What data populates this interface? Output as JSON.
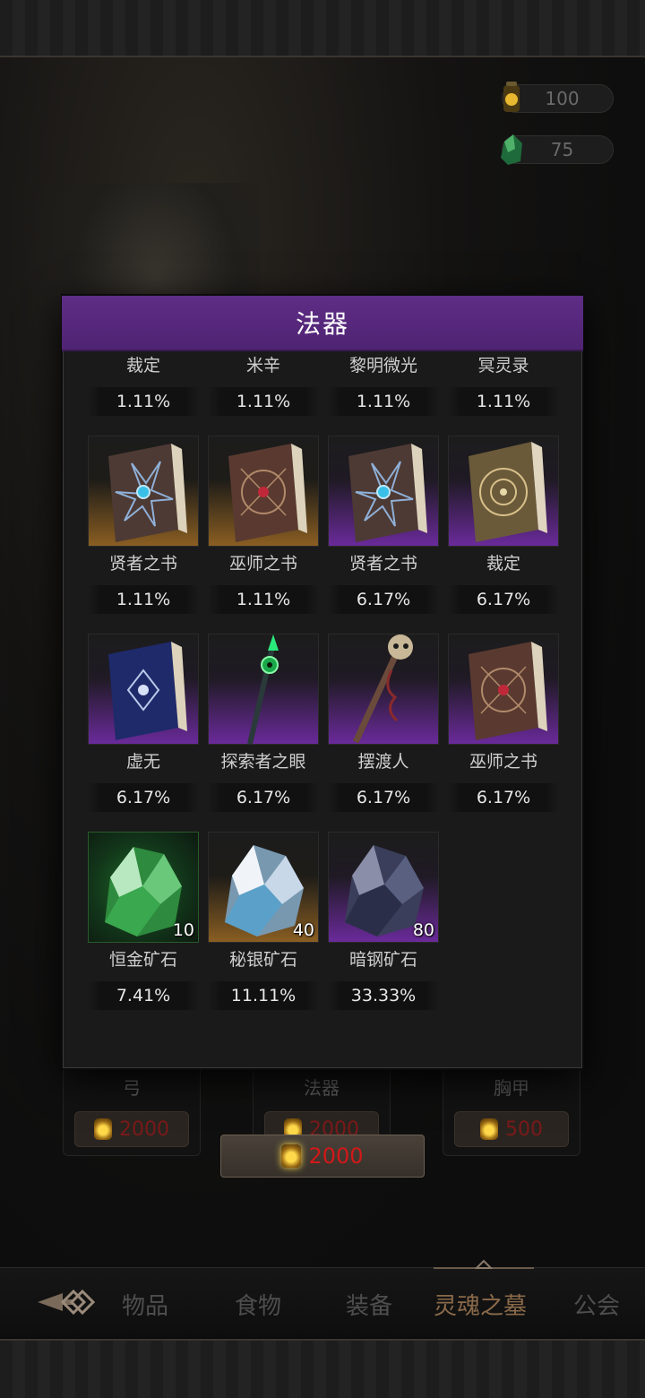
{
  "resources": [
    {
      "icon": "lantern-icon",
      "value": "100"
    },
    {
      "icon": "green-ore-icon",
      "value": "75"
    }
  ],
  "modal": {
    "title": "法器",
    "rows": [
      [
        {
          "name": "裁定",
          "rate": "1.11%",
          "rarity": "gold",
          "icon": "tome-icon"
        },
        {
          "name": "米辛",
          "rate": "1.11%",
          "rarity": "gold",
          "icon": "staff-icon"
        },
        {
          "name": "黎明微光",
          "rate": "1.11%",
          "rarity": "gold",
          "icon": "staff-icon"
        },
        {
          "name": "冥灵录",
          "rate": "1.11%",
          "rarity": "gold",
          "icon": "tome-icon"
        }
      ],
      [
        {
          "name": "贤者之书",
          "rate": "1.11%",
          "rarity": "gold",
          "icon": "sage-book-icon"
        },
        {
          "name": "巫师之书",
          "rate": "1.11%",
          "rarity": "gold",
          "icon": "wizard-book-icon"
        },
        {
          "name": "贤者之书",
          "rate": "6.17%",
          "rarity": "purple",
          "icon": "sage-book-icon"
        },
        {
          "name": "裁定",
          "rate": "6.17%",
          "rarity": "purple",
          "icon": "judgement-tome-icon"
        }
      ],
      [
        {
          "name": "虚无",
          "rate": "6.17%",
          "rarity": "purple",
          "icon": "void-book-icon"
        },
        {
          "name": "探索者之眼",
          "rate": "6.17%",
          "rarity": "purple",
          "icon": "eye-staff-icon"
        },
        {
          "name": "摆渡人",
          "rate": "6.17%",
          "rarity": "purple",
          "icon": "skull-staff-icon"
        },
        {
          "name": "巫师之书",
          "rate": "6.17%",
          "rarity": "purple",
          "icon": "wizard-book-icon"
        }
      ],
      [
        {
          "name": "恒金矿石",
          "rate": "7.41%",
          "rarity": "green",
          "icon": "green-ore-icon",
          "qty": "10"
        },
        {
          "name": "秘银矿石",
          "rate": "11.11%",
          "rarity": "gold",
          "icon": "mithril-ore-icon",
          "qty": "40"
        },
        {
          "name": "暗钢矿石",
          "rate": "33.33%",
          "rarity": "purple",
          "icon": "dark-steel-ore-icon",
          "qty": "80"
        }
      ]
    ]
  },
  "shop": {
    "cards": [
      {
        "label": "弓",
        "price": "2000"
      },
      {
        "label": "法器",
        "price": "2000"
      },
      {
        "label": "胸甲",
        "price": "500"
      }
    ],
    "main_price": "2000"
  },
  "nav": {
    "tabs": [
      "物品",
      "食物",
      "装备",
      "灵魂之墓",
      "公会"
    ],
    "active": "灵魂之墓"
  },
  "colors": {
    "header_purple": "#5e2d86",
    "price_red": "#d21818",
    "gold_rarity": "#8a5e22",
    "purple_rarity": "#6a2a9a"
  }
}
